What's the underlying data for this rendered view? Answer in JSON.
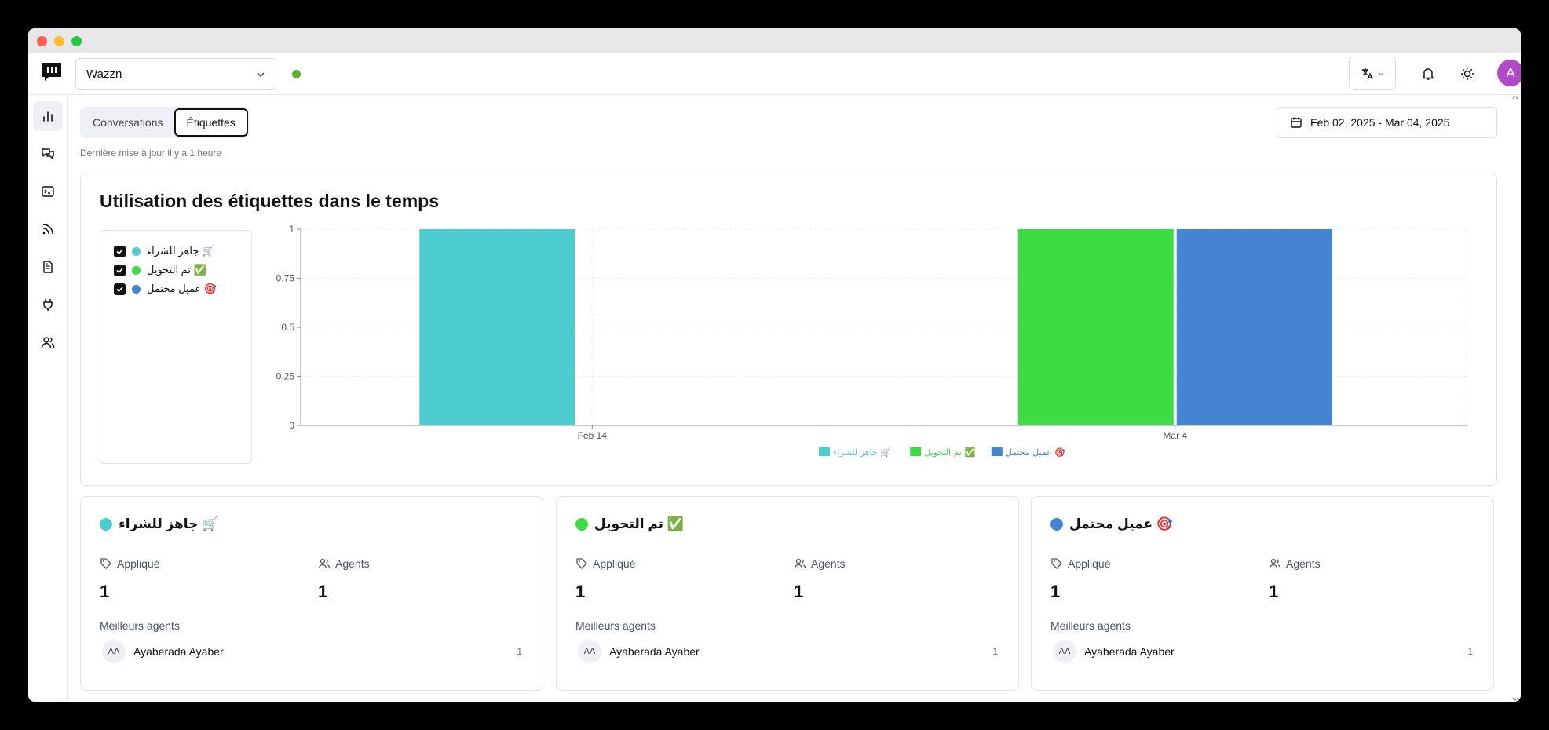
{
  "window": {
    "controls": [
      "#ff5f57",
      "#febc2e",
      "#28c840"
    ]
  },
  "topbar": {
    "workspace": "Wazzn",
    "status_color": "#5cad3a",
    "avatar_letter": "A",
    "avatar_color": "#b048c8",
    "icons": [
      "translate-icon",
      "bell-icon",
      "sun-icon"
    ]
  },
  "sidebar": {
    "items": [
      {
        "name": "reports",
        "icon": "bar-chart-icon",
        "active": true
      },
      {
        "name": "conversations",
        "icon": "chat-icon",
        "active": false
      },
      {
        "name": "terminal",
        "icon": "terminal-icon",
        "active": false
      },
      {
        "name": "feeds",
        "icon": "rss-icon",
        "active": false
      },
      {
        "name": "documents",
        "icon": "document-icon",
        "active": false
      },
      {
        "name": "integrations",
        "icon": "plug-icon",
        "active": false
      },
      {
        "name": "team",
        "icon": "users-icon",
        "active": false
      }
    ]
  },
  "main": {
    "tabs": [
      {
        "label": "Conversations",
        "active": false
      },
      {
        "label": "Étiquettes",
        "active": true
      }
    ],
    "updated": "Dernière mise à jour il y a 1 heure",
    "date_range": "Feb 02, 2025 - Mar 04, 2025"
  },
  "chart_panel": {
    "title": "Utilisation des étiquettes dans le temps",
    "filters": [
      {
        "label": "جاهز للشراء 🛒",
        "color": "#4ecdd0",
        "checked": true
      },
      {
        "label": "تم التحويل ✅",
        "color": "#3ddc45",
        "checked": true
      },
      {
        "label": "عميل محتمل 🎯",
        "color": "#4484d0",
        "checked": true
      }
    ]
  },
  "chart_data": {
    "type": "bar",
    "categories": [
      "Feb 14",
      "Mar 4"
    ],
    "series": [
      {
        "name": "جاهز للشراء 🛒",
        "color": "#4ecdd0",
        "values": [
          1,
          0
        ]
      },
      {
        "name": "تم التحويل ✅",
        "color": "#3ddc45",
        "values": [
          0,
          1
        ]
      },
      {
        "name": "عميل محتمل 🎯",
        "color": "#4484d0",
        "values": [
          0,
          1
        ]
      }
    ],
    "yticks": [
      "0",
      "0.25",
      "0.5",
      "0.75",
      "1"
    ],
    "ylim": [
      0,
      1
    ],
    "grid": true,
    "legend": "bottom"
  },
  "label_cards": [
    {
      "title": "جاهز للشراء 🛒",
      "color": "#4ecdd0",
      "applied_label": "Appliqué",
      "applied": "1",
      "agents_label": "Agents",
      "agents": "1",
      "best_label": "Meilleurs agents",
      "agent_initials": "AA",
      "agent_name": "Ayaberada Ayaber",
      "agent_count": "1"
    },
    {
      "title": "تم التحويل ✅",
      "color": "#3ddc45",
      "applied_label": "Appliqué",
      "applied": "1",
      "agents_label": "Agents",
      "agents": "1",
      "best_label": "Meilleurs agents",
      "agent_initials": "AA",
      "agent_name": "Ayaberada Ayaber",
      "agent_count": "1"
    },
    {
      "title": "عميل محتمل 🎯",
      "color": "#4484d0",
      "applied_label": "Appliqué",
      "applied": "1",
      "agents_label": "Agents",
      "agents": "1",
      "best_label": "Meilleurs agents",
      "agent_initials": "AA",
      "agent_name": "Ayaberada Ayaber",
      "agent_count": "1"
    }
  ]
}
